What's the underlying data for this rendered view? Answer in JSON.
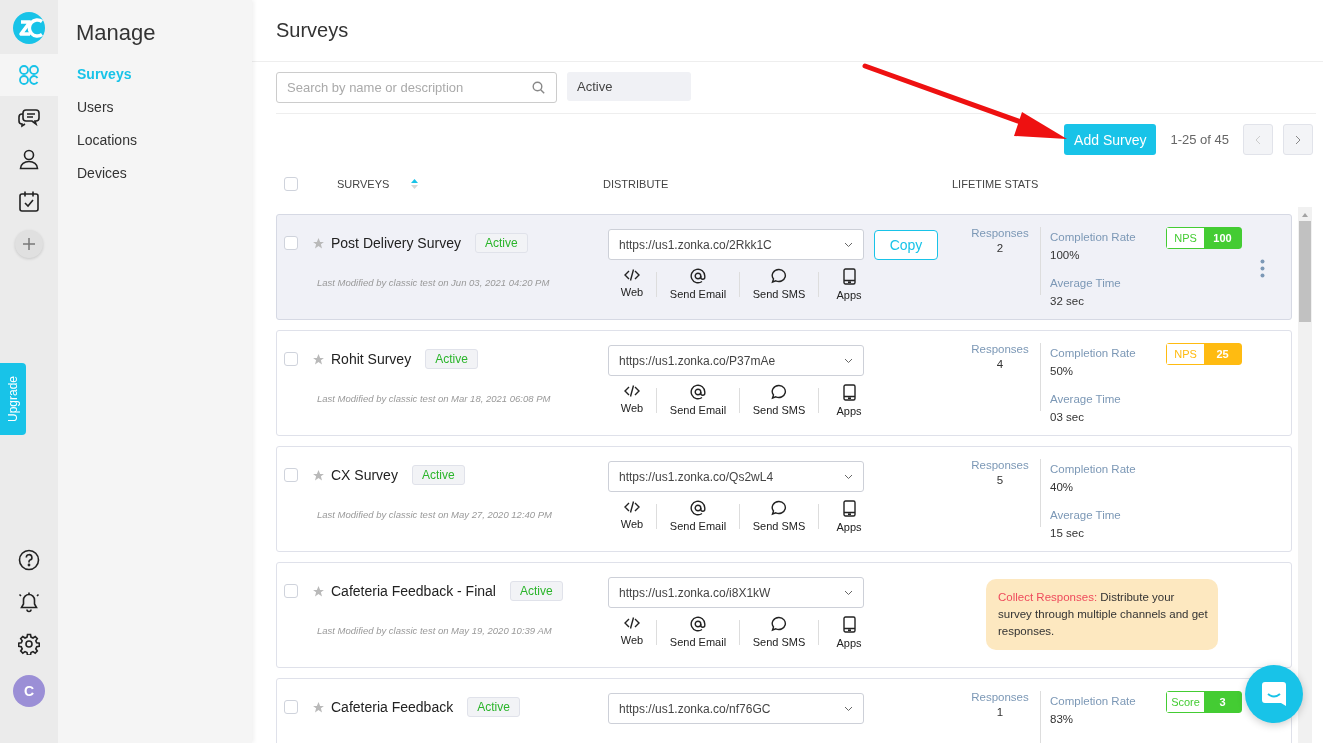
{
  "rail": {
    "nav": [
      {
        "selected": true
      },
      {
        "selected": false
      },
      {
        "selected": false
      },
      {
        "selected": false
      }
    ],
    "upgrade": "Upgrade",
    "avatar": "C"
  },
  "menu": {
    "title": "Manage",
    "items": [
      {
        "label": "Surveys",
        "selected": true
      },
      {
        "label": "Users",
        "selected": false
      },
      {
        "label": "Locations",
        "selected": false
      },
      {
        "label": "Devices",
        "selected": false
      }
    ]
  },
  "page": {
    "title": "Surveys",
    "search": {
      "placeholder": "Search by name or description"
    },
    "filter": "Active",
    "add_button": "Add Survey",
    "pagination": "1-25 of 45"
  },
  "table": {
    "select_all_checked": false,
    "columns": [
      "SURVEYS",
      "DISTRIBUTE",
      "LIFETIME STATS"
    ],
    "cards": [
      {
        "name": "Post Delivery Survey",
        "status": "Active",
        "starred": false,
        "checked": false,
        "selected": true,
        "modified": "Last Modified by classic test on Jun 03, 2021 04:20 PM",
        "url": "https://us1.zonka.co/2Rkk1C",
        "copy": "Copy",
        "channels": [
          "Web",
          "Send Email",
          "Send SMS",
          "Apps"
        ],
        "kind": "stats",
        "stats": {
          "responses_label": "Responses",
          "responses": "2",
          "completion_label": "Completion Rate",
          "completion": "100%",
          "time_label": "Average Time",
          "time": "32 sec"
        },
        "score": {
          "label": "NPS",
          "value": "100",
          "color": "#44cc33"
        },
        "menu_button": true
      },
      {
        "name": "Rohit Survey",
        "status": "Active",
        "starred": false,
        "checked": false,
        "selected": false,
        "modified": "Last Modified by classic test on Mar 18, 2021 06:08 PM",
        "url": "https://us1.zonka.co/P37mAe",
        "channels": [
          "Web",
          "Send Email",
          "Send SMS",
          "Apps"
        ],
        "kind": "stats",
        "stats": {
          "responses_label": "Responses",
          "responses": "4",
          "completion_label": "Completion Rate",
          "completion": "50%",
          "time_label": "Average Time",
          "time": "03 sec"
        },
        "score": {
          "label": "NPS",
          "value": "25",
          "color": "#ffbb11"
        }
      },
      {
        "name": "CX Survey",
        "status": "Active",
        "starred": false,
        "checked": false,
        "selected": false,
        "modified": "Last Modified by classic test on May 27, 2020 12:40 PM",
        "url": "https://us1.zonka.co/Qs2wL4",
        "channels": [
          "Web",
          "Send Email",
          "Send SMS",
          "Apps"
        ],
        "kind": "stats",
        "stats": {
          "responses_label": "Responses",
          "responses": "5",
          "completion_label": "Completion Rate",
          "completion": "40%",
          "time_label": "Average Time",
          "time": "15 sec"
        }
      },
      {
        "name": "Cafeteria Feedback - Final",
        "status": "Active",
        "starred": false,
        "checked": false,
        "selected": false,
        "modified": "Last Modified by classic test on May 19, 2020 10:39 AM",
        "url": "https://us1.zonka.co/i8X1kW",
        "channels": [
          "Web",
          "Send Email",
          "Send SMS",
          "Apps"
        ],
        "kind": "tip",
        "tip": {
          "label": "Collect Responses:",
          "text": "Distribute your survey through multiple channels and get responses."
        }
      },
      {
        "name": "Cafeteria Feedback",
        "status": "Active",
        "starred": false,
        "checked": false,
        "selected": false,
        "url": "https://us1.zonka.co/nf76GC",
        "kind": "stats",
        "stats": {
          "responses_label": "Responses",
          "responses": "1",
          "completion_label": "Completion Rate",
          "completion": "83%"
        },
        "score": {
          "label": "Score",
          "value": "3",
          "color": "#44cc33"
        }
      }
    ]
  }
}
